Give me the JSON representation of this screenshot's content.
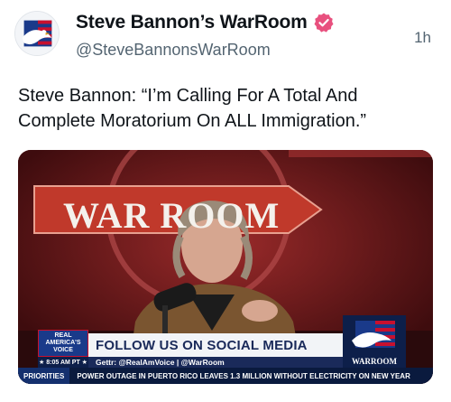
{
  "post": {
    "display_name": "Steve Bannon’s WarRoom",
    "handle": "@SteveBannonsWarRoom",
    "timestamp": "1h",
    "text": "Steve Bannon: “I’m Calling For A Total And Complete Moratorium On ALL Immigration.”",
    "verified_icon": "verified-badge-icon",
    "verified_color": "#e8507e"
  },
  "video": {
    "backdrop_text": "WAR ROOM",
    "chyron_headline": "FOLLOW US ON SOCIAL MEDIA",
    "chyron_subline": "Gettr: @RealAmVoice | @WarRoom",
    "network_line1": "REAL",
    "network_line2": "AMERICA'S",
    "network_line3": "VOICE",
    "time": "★ 8:05 AM PT ★",
    "logo_text": "WARROOM",
    "ticker_label": "PRIORITIES",
    "ticker_text": "POWER OUTAGE IN PUERTO RICO LEAVES 1.3 MILLION WITHOUT ELECTRICITY ON NEW YEAR"
  },
  "colors": {
    "accent_navy": "#1a2a5a",
    "backdrop_red": "#7a1c1e"
  }
}
